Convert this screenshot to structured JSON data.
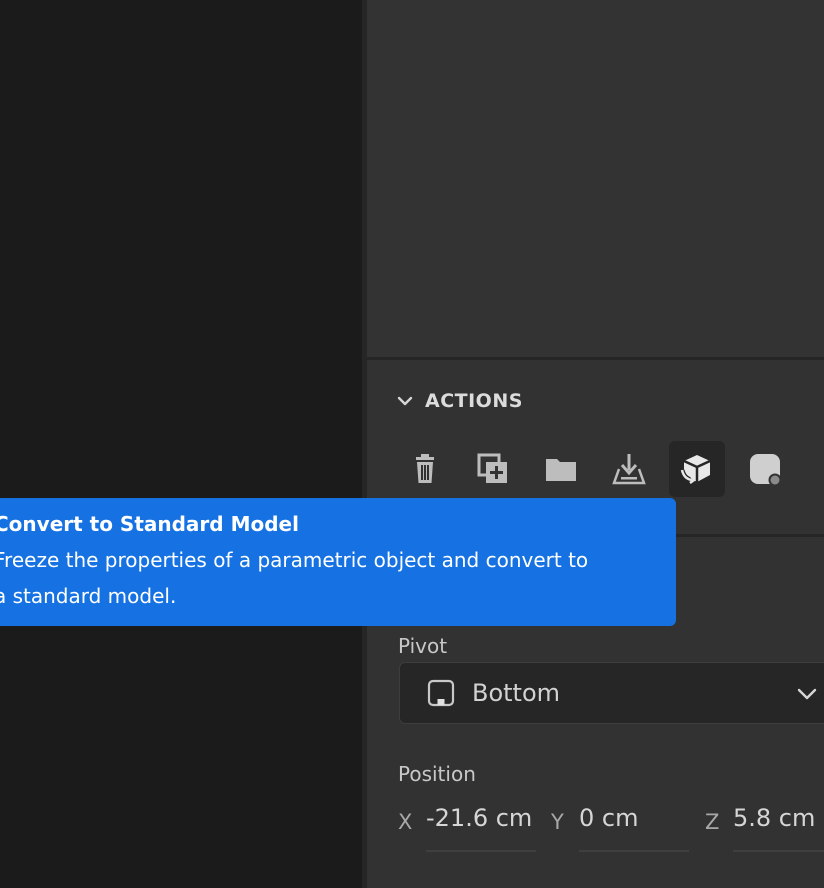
{
  "actions": {
    "title": "ACTIONS",
    "buttons": [
      {
        "name": "delete",
        "icon": "trash-icon"
      },
      {
        "name": "duplicate",
        "icon": "duplicate-icon"
      },
      {
        "name": "group",
        "icon": "folder-icon"
      },
      {
        "name": "drop-to-ground",
        "icon": "drop-to-ground-icon"
      },
      {
        "name": "convert-to-standard-model",
        "icon": "convert-model-icon",
        "active": true
      },
      {
        "name": "make-material",
        "icon": "material-icon"
      }
    ]
  },
  "tooltip": {
    "title": "Convert to Standard Model",
    "body": "Freeze the properties of a parametric object and convert to a standard model."
  },
  "pivot": {
    "label": "Pivot",
    "value": "Bottom",
    "icon": "pivot-bottom-icon"
  },
  "position": {
    "label": "Position",
    "x": {
      "axis": "X",
      "value": "-21.6 cm"
    },
    "y": {
      "axis": "Y",
      "value": "0 cm"
    },
    "z": {
      "axis": "Z",
      "value": "5.8 cm"
    }
  },
  "colors": {
    "tooltip_bg": "#1672e3",
    "panel_bg": "#323232",
    "viewport_bg": "#1b1b1b"
  }
}
